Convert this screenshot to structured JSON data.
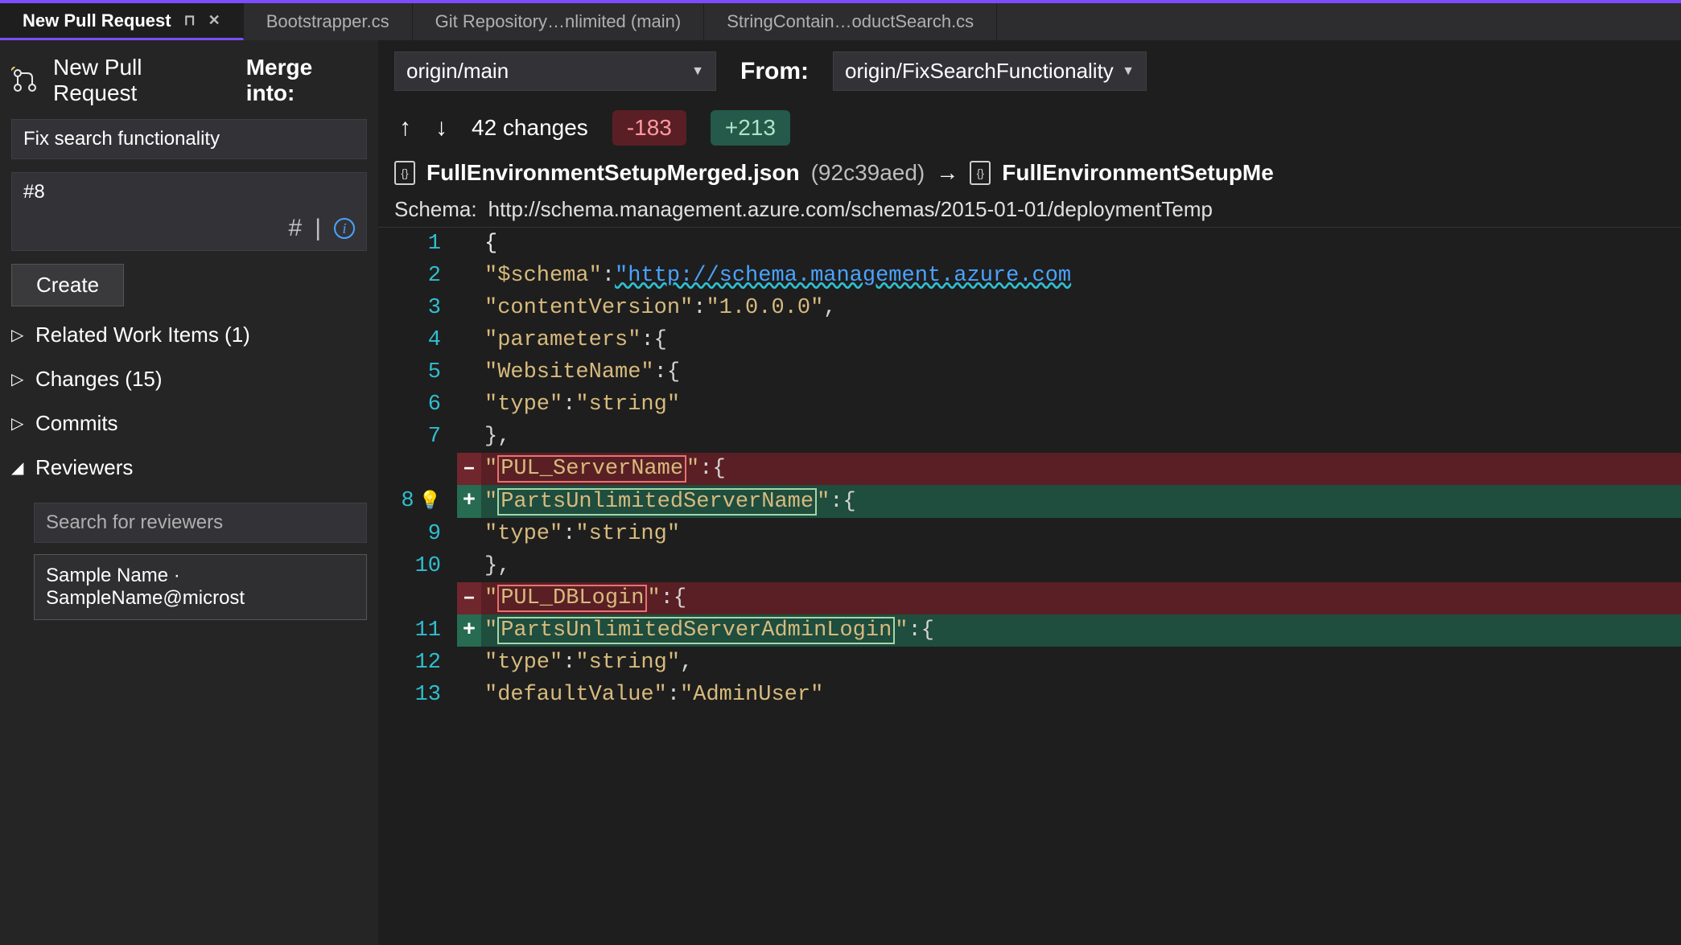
{
  "tabs": [
    {
      "label": "New Pull Request",
      "active": true
    },
    {
      "label": "Bootstrapper.cs",
      "active": false
    },
    {
      "label": "Git Repository…nlimited (main)",
      "active": false
    },
    {
      "label": "StringContain…oductSearch.cs",
      "active": false
    }
  ],
  "side": {
    "title": "New Pull Request",
    "merge_into_label": "Merge into:",
    "title_input": "Fix search functionality",
    "desc_value": "#8",
    "create_label": "Create",
    "sections": {
      "related": "Related Work Items (1)",
      "changes": "Changes (15)",
      "commits": "Commits",
      "reviewers": "Reviewers"
    },
    "reviewer_search_placeholder": "Search for reviewers",
    "reviewer_sample": "Sample Name · SampleName@microst"
  },
  "topbar": {
    "merge_into_label": "Merge into:",
    "merge_into_value": "origin/main",
    "from_label": "From:",
    "from_value": "origin/FixSearchFunctionality"
  },
  "changesbar": {
    "count_label": "42 changes",
    "deletions": "-183",
    "additions": "+213"
  },
  "filebar": {
    "left_name": "FullEnvironmentSetupMerged.json",
    "left_rev": "(92c39aed)",
    "arrow": "→",
    "right_name": "FullEnvironmentSetupMe"
  },
  "schemabar": {
    "label": "Schema:",
    "value": "http://schema.management.azure.com/schemas/2015-01-01/deploymentTemp"
  },
  "code_lines": [
    {
      "n": "1",
      "kind": "ctx",
      "html": "{"
    },
    {
      "n": "2",
      "kind": "ctx",
      "html": "    <span class='tok-key'>\"$schema\"</span><span class='tok-punc'>:</span>  <span class='tok-link'>\"http://schema.management.azure.com</span>"
    },
    {
      "n": "3",
      "kind": "ctx",
      "html": "    <span class='tok-key'>\"contentVersion\"</span><span class='tok-punc'>:</span> <span class='tok-str'>\"1.0.0.0\"</span><span class='tok-punc'>,</span>"
    },
    {
      "n": "4",
      "kind": "ctx",
      "html": "    <span class='tok-key'>\"parameters\"</span><span class='tok-punc'>:</span> <span class='tok-punc'>{</span>"
    },
    {
      "n": "5",
      "kind": "ctx",
      "html": "        <span class='tok-key'>\"WebsiteName\"</span><span class='tok-punc'>:</span> <span class='tok-punc'>{</span>"
    },
    {
      "n": "6",
      "kind": "ctx",
      "html": "            <span class='tok-key'>\"type\"</span><span class='tok-punc'>:</span> <span class='tok-str'>\"string\"</span>"
    },
    {
      "n": "7",
      "kind": "ctx",
      "html": "        <span class='tok-punc'>},</span>"
    },
    {
      "n": "",
      "kind": "del",
      "html": "        <span class='tok-key'>\"<span class='hl-old'>PUL_ServerName</span>\"</span><span class='tok-punc'>:</span> <span class='tok-punc'>{</span>"
    },
    {
      "n": "8",
      "kind": "add",
      "bulb": true,
      "html": "        <span class='tok-key'>\"<span class='hl-new'>PartsUnlimitedServerName</span>\"</span><span class='tok-punc'>:</span> <span class='tok-punc'>{</span>"
    },
    {
      "n": "9",
      "kind": "ctx",
      "html": "            <span class='tok-key'>\"type\"</span><span class='tok-punc'>:</span> <span class='tok-str'>\"string\"</span>"
    },
    {
      "n": "10",
      "kind": "ctx",
      "html": "        <span class='tok-punc'>},</span>"
    },
    {
      "n": "",
      "kind": "del",
      "html": "        <span class='tok-key'>\"<span class='hl-old'>PUL_DBLogin</span>\"</span><span class='tok-punc'>:</span> <span class='tok-punc'>{</span>"
    },
    {
      "n": "11",
      "kind": "add",
      "html": "        <span class='tok-key'>\"<span class='hl-new'>PartsUnlimitedServerAdminLogin</span>\"</span><span class='tok-punc'>:</span> <span class='tok-punc'>{</span>"
    },
    {
      "n": "12",
      "kind": "ctx",
      "html": "            <span class='tok-key'>\"type\"</span><span class='tok-punc'>:</span> <span class='tok-str'>\"string\"</span><span class='tok-punc'>,</span>"
    },
    {
      "n": "13",
      "kind": "ctx",
      "html": "            <span class='tok-key'>\"defaultValue\"</span><span class='tok-punc'>:</span> <span class='tok-str'>\"AdminUser\"</span>"
    }
  ]
}
